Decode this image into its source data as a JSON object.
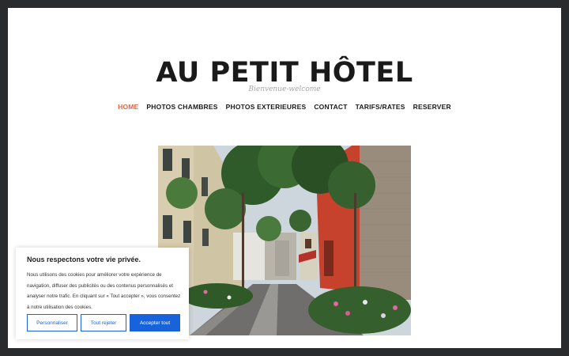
{
  "site": {
    "title": "AU PETIT HÔTEL",
    "tagline": "Bienvenue-welcome"
  },
  "nav": {
    "items": [
      {
        "label": "HOME",
        "active": true
      },
      {
        "label": "PHOTOS CHAMBRES",
        "active": false
      },
      {
        "label": "PHOTOS EXTERIEURES",
        "active": false
      },
      {
        "label": "CONTACT",
        "active": false
      },
      {
        "label": "TARIFS/RATES",
        "active": false
      },
      {
        "label": "RESERVER",
        "active": false
      }
    ],
    "active_color": "#d9684a"
  },
  "cookie_banner": {
    "title": "Nous respectons votre vie privée.",
    "text": "Nous utilisons des cookies pour améliorer votre expérience de navigation, diffuser des publicités ou des contenus personnalisés et analyser notre trafic. En cliquant sur « Tout accepter », vous consentez à notre utilisation des cookies.",
    "buttons": {
      "customize": "Personnaliser",
      "reject": "Tout rejeter",
      "accept": "Accepter tout"
    },
    "accent_color": "#1863dc"
  },
  "hero": {
    "icon": "street-photo"
  }
}
